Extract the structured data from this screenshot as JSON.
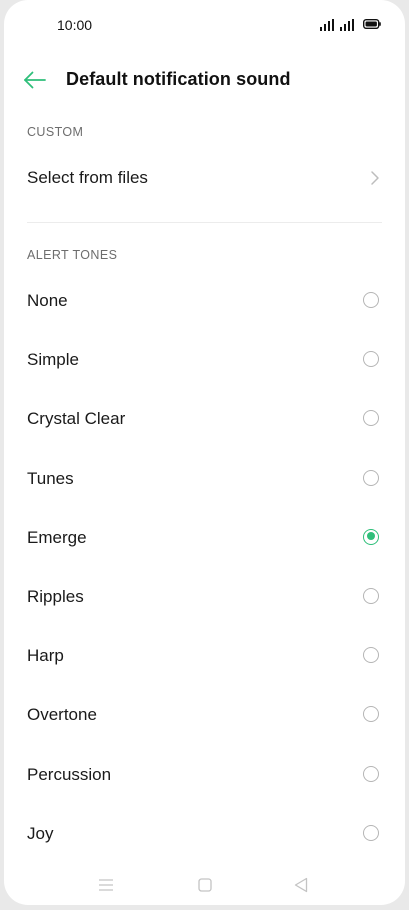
{
  "status_bar": {
    "time": "10:00"
  },
  "header": {
    "title": "Default notification sound",
    "back_icon": "arrow-left-icon"
  },
  "custom_section": {
    "label": "CUSTOM",
    "select_from_files": "Select from files"
  },
  "alert_section": {
    "label": "ALERT TONES",
    "tones": [
      {
        "label": "None",
        "selected": false
      },
      {
        "label": "Simple",
        "selected": false
      },
      {
        "label": "Crystal Clear",
        "selected": false
      },
      {
        "label": "Tunes",
        "selected": false
      },
      {
        "label": "Emerge",
        "selected": true
      },
      {
        "label": "Ripples",
        "selected": false
      },
      {
        "label": "Harp",
        "selected": false
      },
      {
        "label": "Overtone",
        "selected": false
      },
      {
        "label": "Percussion",
        "selected": false
      },
      {
        "label": "Joy",
        "selected": false
      }
    ]
  },
  "colors": {
    "accent": "#2fbf7a",
    "text": "#1a1a1a",
    "section_label": "#6d6d6d"
  },
  "nav_bar": {
    "icons": [
      "menu-icon",
      "home-square-icon",
      "back-triangle-icon"
    ]
  }
}
